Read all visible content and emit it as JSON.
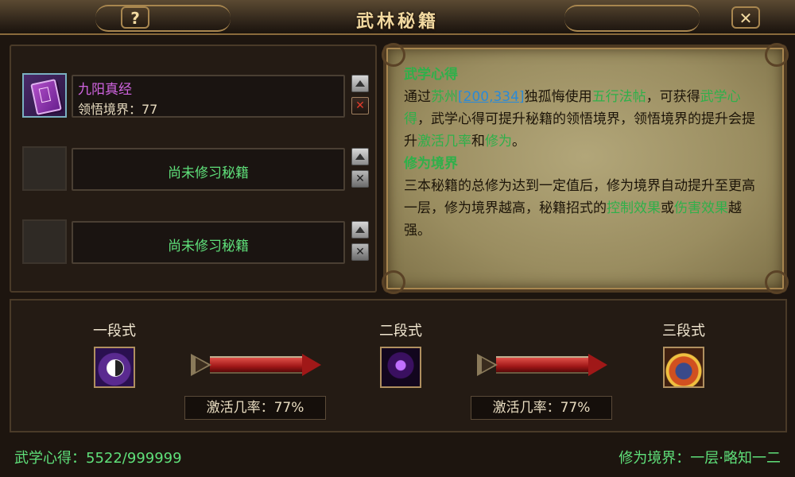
{
  "window": {
    "title": "武林秘籍",
    "help_label": "?",
    "close_label": "✕"
  },
  "slots": [
    {
      "name": "九阳真经",
      "level_label": "领悟境界：77",
      "empty": false
    },
    {
      "empty_label": "尚未修习秘籍",
      "empty": true
    },
    {
      "empty_label": "尚未修习秘籍",
      "empty": true
    }
  ],
  "info": {
    "section1_title": "武学心得",
    "section1_parts": {
      "p1": "通过",
      "place": "苏州",
      "coords": "[200,334]",
      "npc": "独孤悔",
      "p2": "使用",
      "item": "五行法帖",
      "p3": "，可获得",
      "term1": "武学心得",
      "p4": "，武学心得可提升秘籍的领悟境界，领悟境界的提升会提升",
      "term2": "激活几率",
      "p5": "和",
      "term3": "修为",
      "p6": "。"
    },
    "section2_title": "修为境界",
    "section2_parts": {
      "p1": "三本秘籍的总修为达到一定值后，修为境界自动提升至更高一层，修为境界越高，秘籍招式的",
      "term1": "控制效果",
      "p2": "或",
      "term2": "伤害效果",
      "p3": "越强。"
    }
  },
  "stages": [
    {
      "label": "一段式",
      "icon": "yin-yang-skill-icon"
    },
    {
      "label": "二段式",
      "icon": "shadow-figure-skill-icon"
    },
    {
      "label": "三段式",
      "icon": "armored-warrior-skill-icon"
    }
  ],
  "rates": [
    {
      "label": "激活几率：77%"
    },
    {
      "label": "激活几率：77%"
    }
  ],
  "footer": {
    "martial_insight": "武学心得：5522/999999",
    "cultivation_level": "修为境界：一层·略知一二"
  },
  "colors": {
    "green_text": "#5fe07a",
    "purple_name": "#d064e0",
    "link_blue": "#2a8ad8",
    "gold_title": "#f2d9a0"
  }
}
